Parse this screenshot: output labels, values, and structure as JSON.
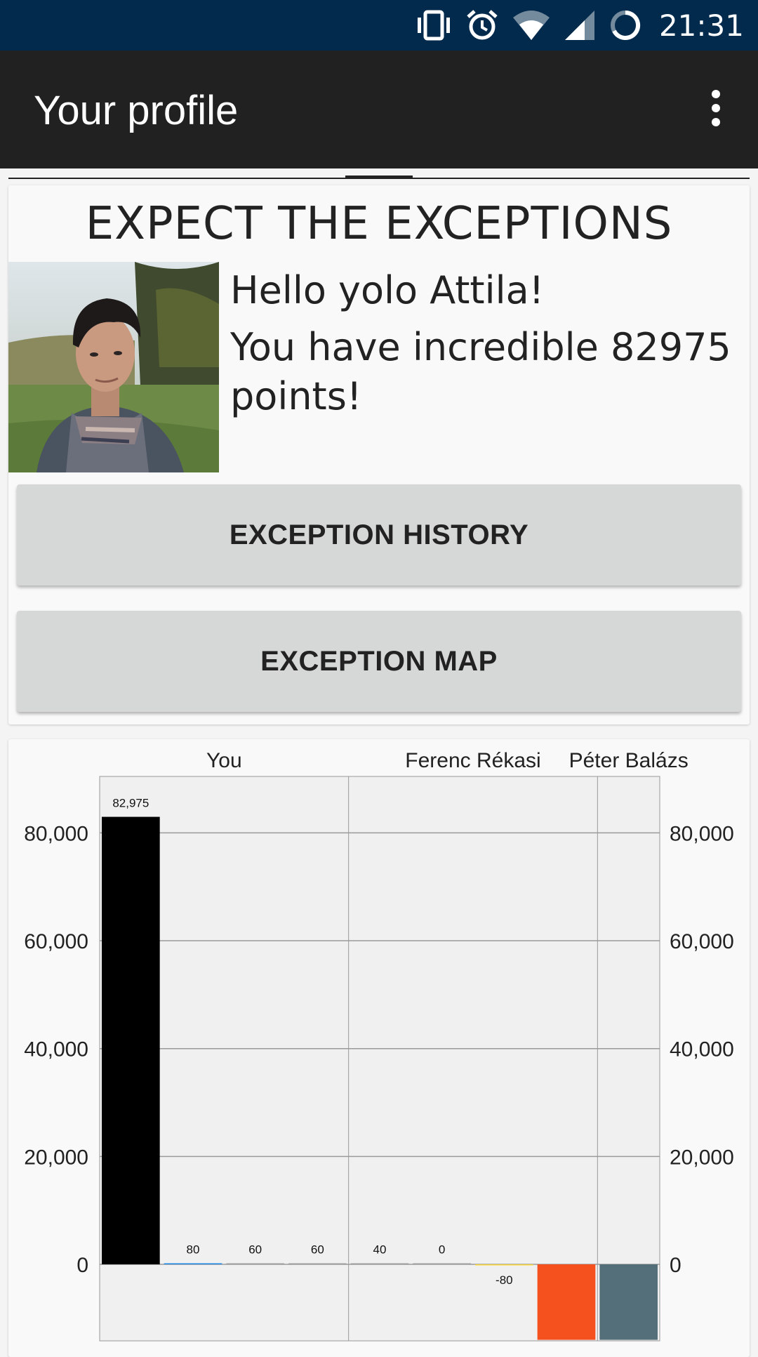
{
  "status_bar": {
    "time": "21:31",
    "icons": [
      "vibrate-icon",
      "alarm-icon",
      "wifi-icon",
      "cell-signal-icon",
      "battery-icon"
    ]
  },
  "app_bar": {
    "title": "Your profile",
    "menu_icon": "overflow-menu-icon"
  },
  "profile": {
    "headline": "EXPECT THE EXCEPTIONS",
    "greeting": "Hello yolo Attila!",
    "points_text": "You have incredible 82975 points!",
    "avatar_icon": "profile-photo"
  },
  "buttons": {
    "history": "EXCEPTION HISTORY",
    "map": "EXCEPTION MAP"
  },
  "colors": {
    "status_bar": "#022a4d",
    "app_bar": "#212121",
    "button": "#d6d7d7",
    "plot_bg": "#f0f0f0"
  },
  "chart_data": {
    "type": "bar",
    "groups": [
      "You",
      "Ferenc Rékasi",
      "Péter Balázs"
    ],
    "series": [
      {
        "group": "You",
        "value": 82975,
        "label": "82,975",
        "color": "#000000"
      },
      {
        "group": "You",
        "value": 80,
        "label": "80",
        "color": "#1e88e5"
      },
      {
        "group": "You",
        "value": 60,
        "label": "60",
        "color": "#9e9e9e"
      },
      {
        "group": "You",
        "value": 60,
        "label": "60",
        "color": "#9e9e9e"
      },
      {
        "group": "Ferenc Rékasi",
        "value": 40,
        "label": "40",
        "color": "#9e9e9e"
      },
      {
        "group": "Ferenc Rékasi",
        "value": 0,
        "label": "0",
        "color": "#9e9e9e"
      },
      {
        "group": "Ferenc Rékasi",
        "value": -80,
        "label": "-80",
        "color": "#fdd835"
      },
      {
        "group": "Ferenc Rékasi",
        "value": -14000,
        "label": "",
        "color": "#f4511e"
      },
      {
        "group": "Péter Balázs",
        "value": -14000,
        "label": "",
        "color": "#546e7a"
      }
    ],
    "y_ticks": [
      0,
      20000,
      40000,
      60000,
      80000
    ],
    "y_tick_labels": [
      "0",
      "20,000",
      "40,000",
      "60,000",
      "80,000"
    ],
    "ylim": [
      -14000,
      91000
    ],
    "grid": true,
    "dual_y_axis": true
  }
}
